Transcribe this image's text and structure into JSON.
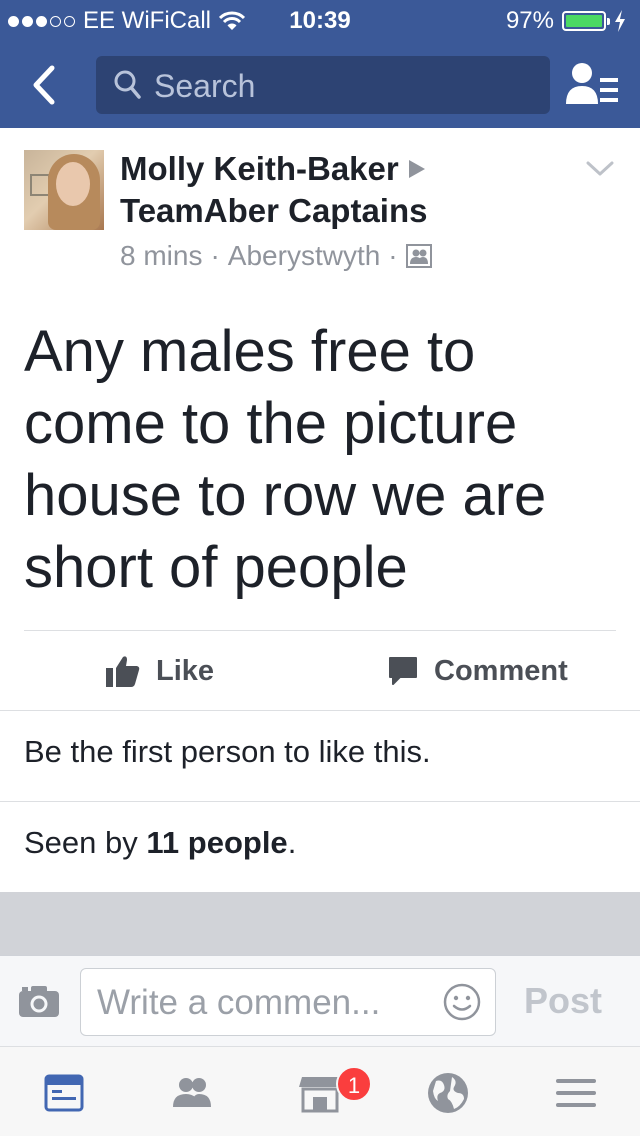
{
  "status_bar": {
    "carrier": "EE WiFiCall",
    "time": "10:39",
    "battery": "97%"
  },
  "nav": {
    "search_placeholder": "Search"
  },
  "post": {
    "author": "Molly Keith-Baker",
    "group": "TeamAber Captains",
    "time_ago": "8 mins",
    "separator": "·",
    "location": "Aberystwyth",
    "text": "Any males free to come to the picture house to row we are short of people"
  },
  "actions": {
    "like_label": "Like",
    "comment_label": "Comment"
  },
  "engagement": {
    "likes_text": "Be the first person to like this.",
    "seen_prefix": "Seen by",
    "seen_count": "11 people",
    "seen_suffix": "."
  },
  "composer": {
    "placeholder": "Write a commen...",
    "post_label": "Post"
  },
  "tabbar": {
    "marketplace_badge": "1"
  },
  "colors": {
    "brand": "#3b5998",
    "active_tab": "#4267b2",
    "badge": "#fa3e3e"
  }
}
